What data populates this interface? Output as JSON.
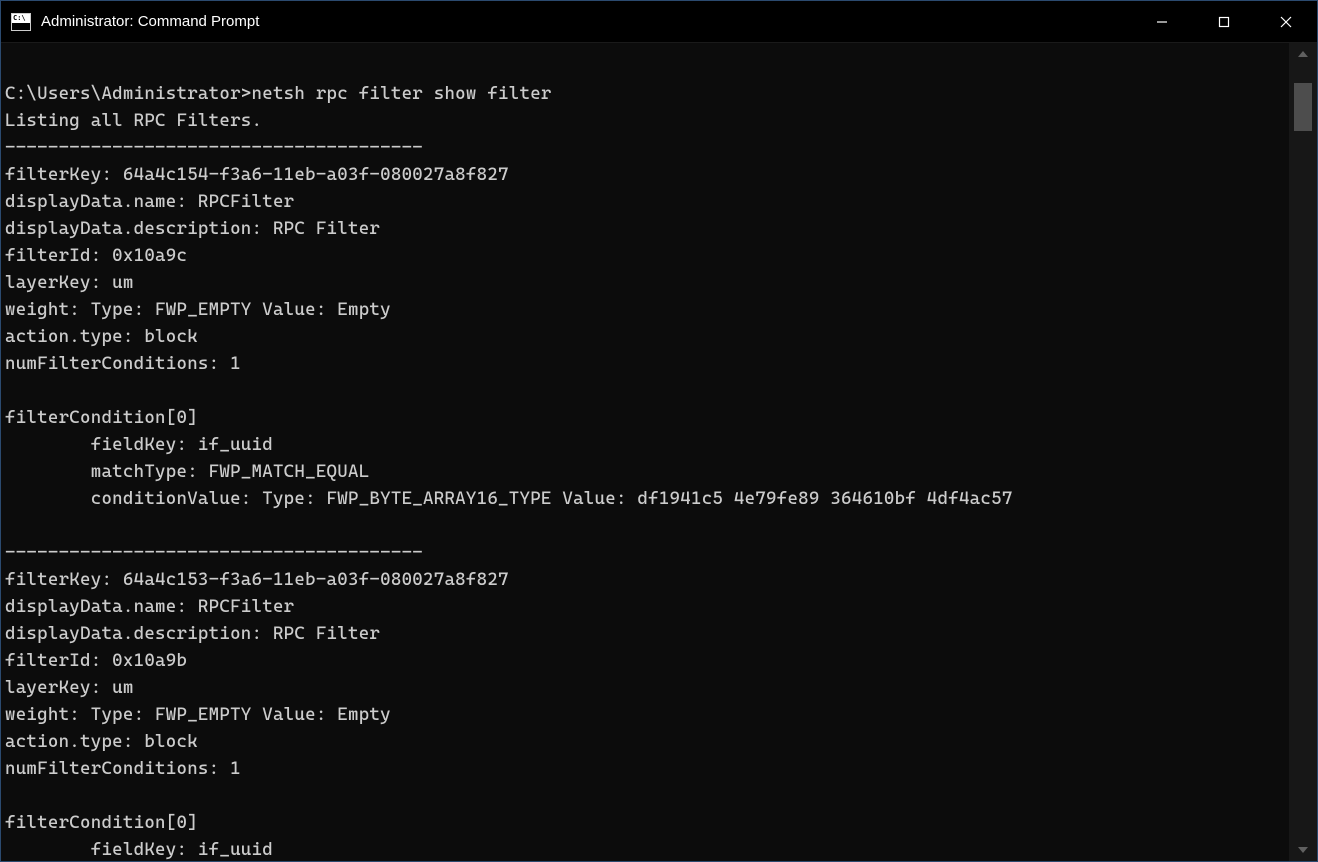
{
  "window": {
    "title": "Administrator: Command Prompt"
  },
  "terminal": {
    "prompt": "C:\\Users\\Administrator>",
    "command": "netsh rpc filter show filter",
    "lines": [
      "Listing all RPC Filters.",
      "---------------------------------------",
      "filterKey: 64a4c154-f3a6-11eb-a03f-080027a8f827",
      "displayData.name: RPCFilter",
      "displayData.description: RPC Filter",
      "filterId: 0x10a9c",
      "layerKey: um",
      "weight: Type: FWP_EMPTY Value: Empty",
      "action.type: block",
      "numFilterConditions: 1",
      "",
      "filterCondition[0]",
      "        fieldKey: if_uuid",
      "        matchType: FWP_MATCH_EQUAL",
      "        conditionValue: Type: FWP_BYTE_ARRAY16_TYPE Value: df1941c5 4e79fe89 364610bf 4df4ac57",
      "",
      "---------------------------------------",
      "filterKey: 64a4c153-f3a6-11eb-a03f-080027a8f827",
      "displayData.name: RPCFilter",
      "displayData.description: RPC Filter",
      "filterId: 0x10a9b",
      "layerKey: um",
      "weight: Type: FWP_EMPTY Value: Empty",
      "action.type: block",
      "numFilterConditions: 1",
      "",
      "filterCondition[0]",
      "        fieldKey: if_uuid"
    ]
  }
}
